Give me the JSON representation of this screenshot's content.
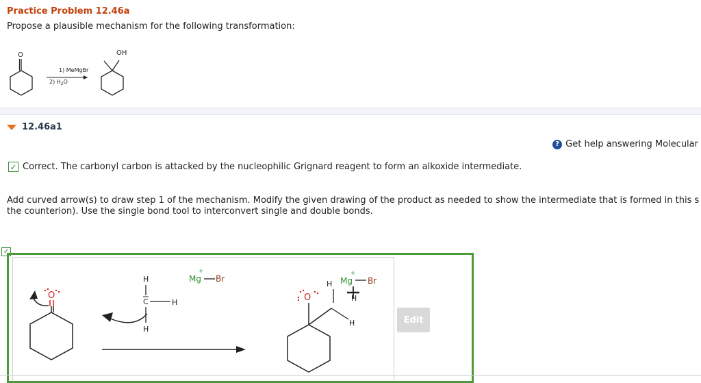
{
  "problem": {
    "title": "Practice Problem 12.46a",
    "prompt": "Propose a plausible mechanism for the following transformation:"
  },
  "reaction": {
    "reagent_line1": "1) MeMgBr",
    "reagent_line2_prefix": "2) H",
    "reagent_line2_sub": "2",
    "reagent_line2_suffix": "O",
    "reactant_atom": "O",
    "product_atom": "OH"
  },
  "part": {
    "label": "12.46a1"
  },
  "help": {
    "icon": "?",
    "text": "Get help answering Molecular"
  },
  "feedback": {
    "check": "✓",
    "text": "Correct. The carbonyl carbon is attacked by the nucleophilic Grignard reagent to form an alkoxide intermediate."
  },
  "instructions": {
    "line1": "Add curved arrow(s) to draw step 1 of the mechanism. Modify the given drawing of the product as needed to show the intermediate that is formed in this s",
    "line2": "the counterion). Use the single bond tool to interconvert single and double bonds."
  },
  "editor": {
    "status_check": "✓",
    "edit_label": "Edit",
    "left": {
      "o": "O",
      "h_top": "H",
      "c": "C",
      "h_right": "H",
      "h_bottom": "H",
      "mg": "Mg",
      "br": "Br",
      "plus": "+",
      "dash": "—"
    },
    "right": {
      "o": "O",
      "h_left": "H",
      "mg": "Mg",
      "br": "Br",
      "plus": "+",
      "h_a": "H",
      "h_b": "H",
      "dash": "—"
    }
  },
  "colors": {
    "title": "#c2410c",
    "correct": "#3a8c3a",
    "mg": "#2e8b2e",
    "br": "#8b3a1a",
    "oxygen": "#cc2222"
  }
}
